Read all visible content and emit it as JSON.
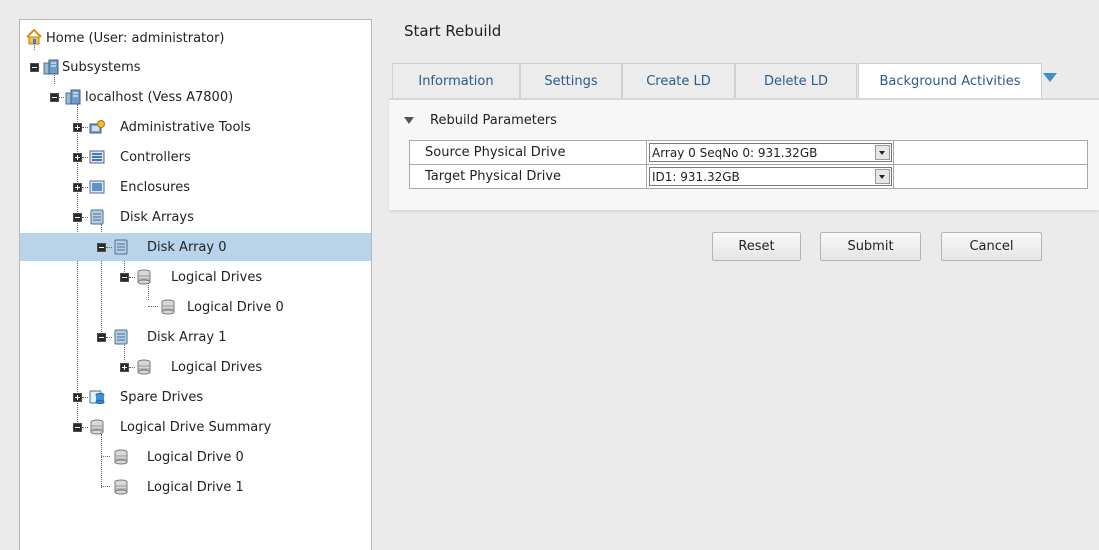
{
  "tree": {
    "nodes": [
      {
        "label": "Home (User: administrator)",
        "icon": "home-icon"
      },
      {
        "label": "Subsystems",
        "icon": "subsystem-icon"
      },
      {
        "label": "localhost (Vess A7800)",
        "icon": "server-icon"
      },
      {
        "label": "Administrative Tools",
        "icon": "admin-tools-icon"
      },
      {
        "label": "Controllers",
        "icon": "controller-icon"
      },
      {
        "label": "Enclosures",
        "icon": "enclosure-icon"
      },
      {
        "label": "Disk Arrays",
        "icon": "disk-arrays-icon"
      },
      {
        "label": "Disk Array 0",
        "icon": "disk-array-icon"
      },
      {
        "label": "Logical Drives",
        "icon": "logical-drives-icon"
      },
      {
        "label": "Logical Drive 0",
        "icon": "logical-drive-icon"
      },
      {
        "label": "Disk Array 1",
        "icon": "disk-array-icon"
      },
      {
        "label": "Logical Drives",
        "icon": "logical-drives-icon"
      },
      {
        "label": "Spare Drives",
        "icon": "spare-drives-icon"
      },
      {
        "label": "Logical Drive Summary",
        "icon": "logical-drive-summary-icon"
      },
      {
        "label": "Logical Drive 0",
        "icon": "logical-drive-icon"
      },
      {
        "label": "Logical Drive 1",
        "icon": "logical-drive-icon"
      }
    ],
    "selected": "Disk Array 0"
  },
  "page": {
    "title": "Start Rebuild"
  },
  "tabs": [
    {
      "label": "Information"
    },
    {
      "label": "Settings"
    },
    {
      "label": "Create LD"
    },
    {
      "label": "Delete LD"
    },
    {
      "label": "Background Activities"
    }
  ],
  "active_tab": "Background Activities",
  "section": {
    "title": "Rebuild Parameters",
    "rows": [
      {
        "label": "Source Physical Drive",
        "value": "Array 0 SeqNo 0: 931.32GB"
      },
      {
        "label": "Target Physical Drive",
        "value": "ID1: 931.32GB"
      }
    ]
  },
  "buttons": {
    "reset": "Reset",
    "submit": "Submit",
    "cancel": "Cancel"
  },
  "colors": {
    "selected_row": "#b9d4e8",
    "tab_text": "#2c5a8a",
    "dropdown_arrow": "#3d8fd4"
  }
}
